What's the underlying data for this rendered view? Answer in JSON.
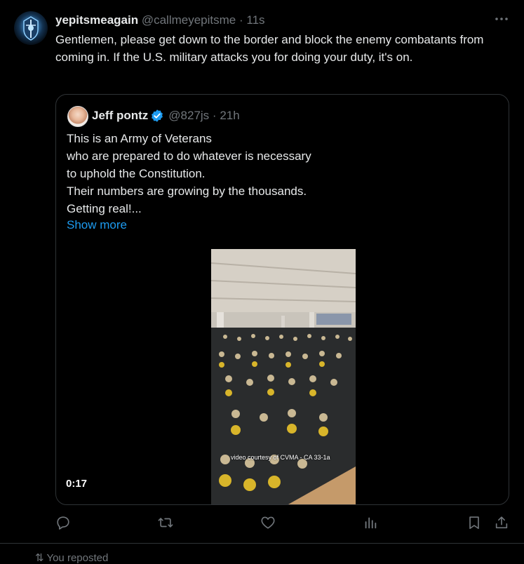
{
  "tweet": {
    "display_name": "yepitsmeagain",
    "handle": "@callmeyepitsme",
    "separator": "·",
    "time": "11s",
    "text": "Gentlemen, please get down to the border and block the enemy combatants from coming in.  If the U.S. military attacks you for doing your duty, it's on."
  },
  "quoted": {
    "display_name": "Jeff pontz",
    "handle": "@827js",
    "separator": "·",
    "time": "21h",
    "lines": [
      "This is an Army of Veterans",
      "who are prepared to do whatever is necessary",
      "to uphold the Constitution.",
      "Their numbers are growing by the thousands.",
      "Getting real!..."
    ],
    "show_more": "Show more",
    "video": {
      "caption": "video courtesy of CVMA - CA 33-1a",
      "duration": "0:17"
    }
  },
  "actions": {
    "reply_icon": "reply-icon",
    "retweet_icon": "retweet-icon",
    "like_icon": "like-icon",
    "views_icon": "views-icon",
    "bookmark_icon": "bookmark-icon",
    "share_icon": "share-icon"
  },
  "next_row_partial": "⇅  You reposted",
  "colors": {
    "background": "#000000",
    "text": "#e7e9ea",
    "muted": "#71767b",
    "link": "#1d9bf0",
    "border": "#2f3336",
    "verified": "#1d9bf0"
  }
}
